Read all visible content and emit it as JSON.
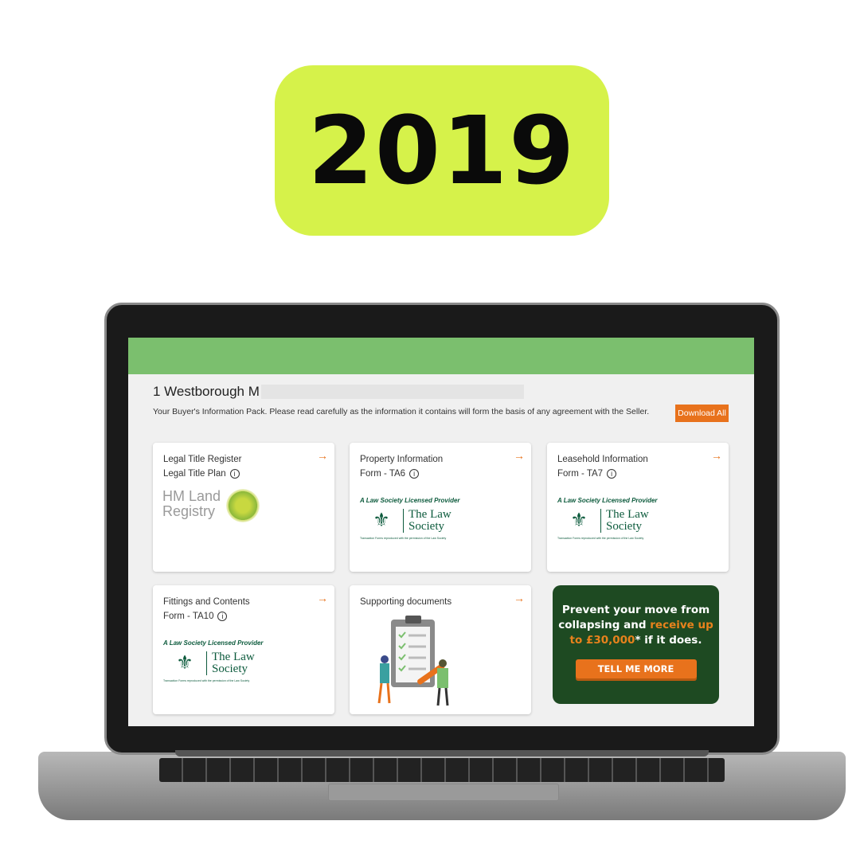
{
  "badge": {
    "year": "2019",
    "color": "#d6f24a"
  },
  "page": {
    "title": "1 Westborough M",
    "subtitle": "Your Buyer's Information Pack. Please read carefully as the information it contains will form the basis of any agreement with the Seller.",
    "download_all": "Download All",
    "header_color": "#7bbf6e",
    "accent": "#e8721c"
  },
  "cards": [
    {
      "line1": "Legal Title Register",
      "line2": "Legal Title Plan",
      "logo": "HM Land Registry",
      "logo_lines": [
        "HM Land",
        "Registry"
      ]
    },
    {
      "line1": "Property Information",
      "line2": "Form - TA6",
      "logo": "law-society"
    },
    {
      "line1": "Leasehold Information",
      "line2": "Form - TA7",
      "logo": "law-society"
    },
    {
      "line1": "Fittings and Contents",
      "line2": "Form - TA10",
      "logo": "law-society"
    },
    {
      "line1": "Supporting documents",
      "logo": "clipboard-illustration"
    }
  ],
  "law_society": {
    "tagline": "A Law Society Licensed Provider",
    "name": "The Law Society",
    "name_lines": [
      "The Law",
      "Society"
    ],
    "fine": "Transaction Forms reproduced with the permission of the Law Society"
  },
  "ad": {
    "text_a": "Prevent your move from collapsing and ",
    "text_b": "receive up to £30,000",
    "text_c": "* if it does.",
    "button": "TELL ME MORE"
  }
}
